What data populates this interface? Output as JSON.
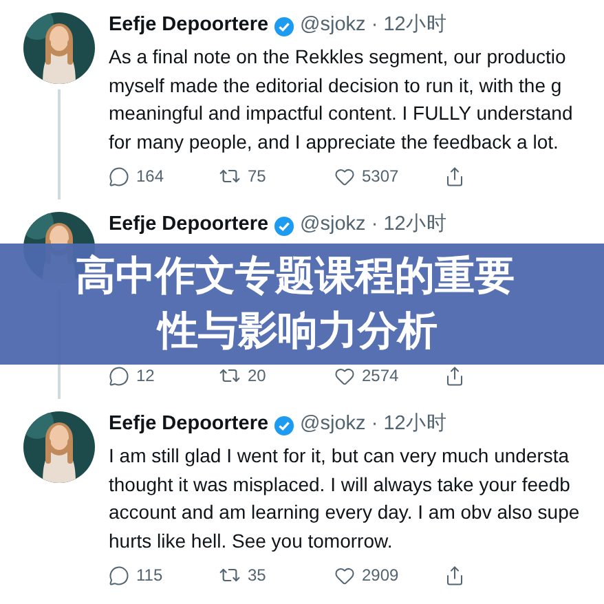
{
  "tweets": [
    {
      "author": "Eefje Depoortere",
      "verified": true,
      "meta": "@sjokz · 12小时",
      "lines": [
        "As a final note on the Rekkles segment, our productio",
        "myself made the editorial decision to run it, with the g",
        "meaningful and impactful content. I FULLY understand",
        "for many people, and I appreciate the feedback a lot."
      ],
      "replies": "164",
      "retweets": "75",
      "likes": "5307"
    },
    {
      "author": "Eefje Depoortere",
      "verified": true,
      "meta": "@sjokz · 12小时",
      "replies": "12",
      "retweets": "20",
      "likes": "2574"
    },
    {
      "author": "Eefje Depoortere",
      "verified": true,
      "meta": "@sjokz · 12小时",
      "lines": [
        "I am still glad I went for it, but can very much understa",
        "thought it was misplaced. I will always take your feedb",
        "account and am learning every day. I am obv also supe",
        "hurts like hell. See you tomorrow."
      ],
      "replies": "115",
      "retweets": "35",
      "likes": "2909"
    }
  ],
  "banner": {
    "lines": [
      "高中作文专题课程的重要",
      "性与影响力分析"
    ]
  }
}
